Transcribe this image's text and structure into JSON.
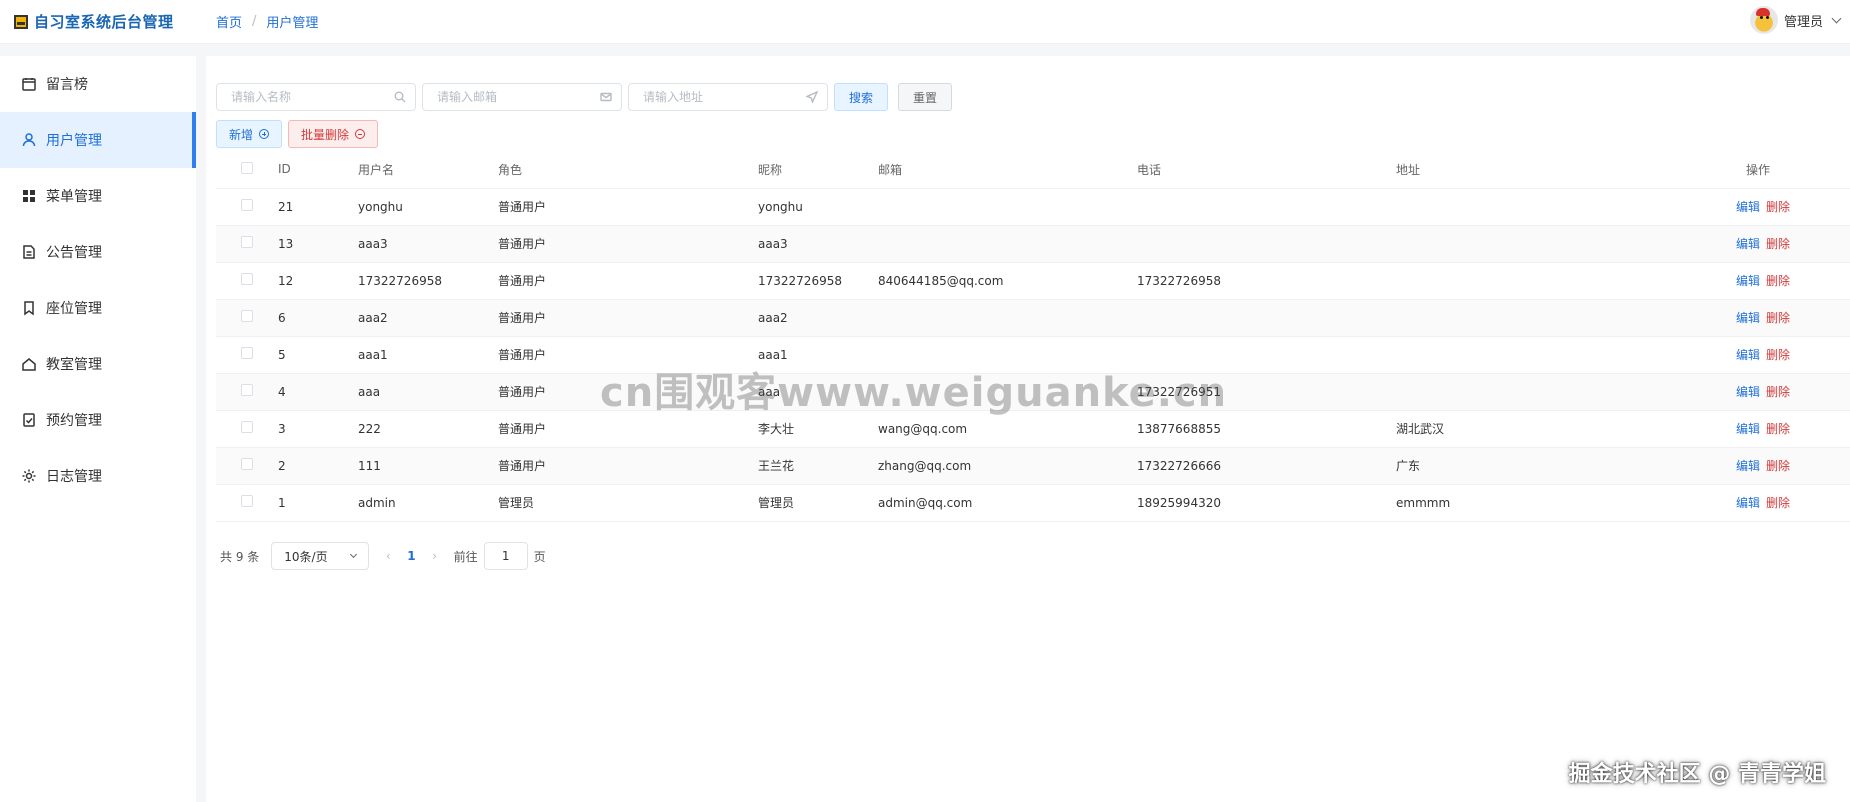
{
  "header": {
    "app_title": "自习室系统后台管理",
    "breadcrumb": [
      "首页",
      "用户管理"
    ],
    "user_name": "管理员"
  },
  "sidebar": {
    "items": [
      {
        "label": "留言榜",
        "icon": "calendar-icon"
      },
      {
        "label": "用户管理",
        "icon": "user-icon",
        "active": true
      },
      {
        "label": "菜单管理",
        "icon": "grid-icon"
      },
      {
        "label": "公告管理",
        "icon": "document-icon"
      },
      {
        "label": "座位管理",
        "icon": "bookmark-icon"
      },
      {
        "label": "教室管理",
        "icon": "home-icon"
      },
      {
        "label": "预约管理",
        "icon": "checklist-icon"
      },
      {
        "label": "日志管理",
        "icon": "gear-icon"
      }
    ]
  },
  "filters": {
    "name_placeholder": "请输入名称",
    "email_placeholder": "请输入邮箱",
    "address_placeholder": "请输入地址",
    "search_label": "搜索",
    "reset_label": "重置"
  },
  "actions": {
    "add_label": "新增",
    "bulk_delete_label": "批量删除"
  },
  "table": {
    "columns": [
      "ID",
      "用户名",
      "角色",
      "昵称",
      "邮箱",
      "电话",
      "地址",
      "操作"
    ],
    "edit_label": "编辑",
    "delete_label": "删除",
    "rows": [
      {
        "id": "21",
        "username": "yonghu",
        "role": "普通用户",
        "nickname": "yonghu",
        "email": "",
        "phone": "",
        "address": ""
      },
      {
        "id": "13",
        "username": "aaa3",
        "role": "普通用户",
        "nickname": "aaa3",
        "email": "",
        "phone": "",
        "address": ""
      },
      {
        "id": "12",
        "username": "17322726958",
        "role": "普通用户",
        "nickname": "17322726958",
        "email": "840644185@qq.com",
        "phone": "17322726958",
        "address": ""
      },
      {
        "id": "6",
        "username": "aaa2",
        "role": "普通用户",
        "nickname": "aaa2",
        "email": "",
        "phone": "",
        "address": ""
      },
      {
        "id": "5",
        "username": "aaa1",
        "role": "普通用户",
        "nickname": "aaa1",
        "email": "",
        "phone": "",
        "address": ""
      },
      {
        "id": "4",
        "username": "aaa",
        "role": "普通用户",
        "nickname": "aaa",
        "email": "",
        "phone": "17322726951",
        "address": ""
      },
      {
        "id": "3",
        "username": "222",
        "role": "普通用户",
        "nickname": "李大壮",
        "email": "wang@qq.com",
        "phone": "13877668855",
        "address": "湖北武汉"
      },
      {
        "id": "2",
        "username": "111",
        "role": "普通用户",
        "nickname": "王兰花",
        "email": "zhang@qq.com",
        "phone": "17322726666",
        "address": "广东"
      },
      {
        "id": "1",
        "username": "admin",
        "role": "管理员",
        "nickname": "管理员",
        "email": "admin@qq.com",
        "phone": "18925994320",
        "address": "emmmm"
      }
    ]
  },
  "pagination": {
    "total_text": "共 9 条",
    "page_size": "10条/页",
    "current_page": "1",
    "goto_label": "前往",
    "goto_value": "1",
    "page_suffix": "页"
  },
  "watermarks": {
    "center": "cn围观客www.weiguanke.cn",
    "corner": "掘金技术社区 @ 青青学姐"
  }
}
